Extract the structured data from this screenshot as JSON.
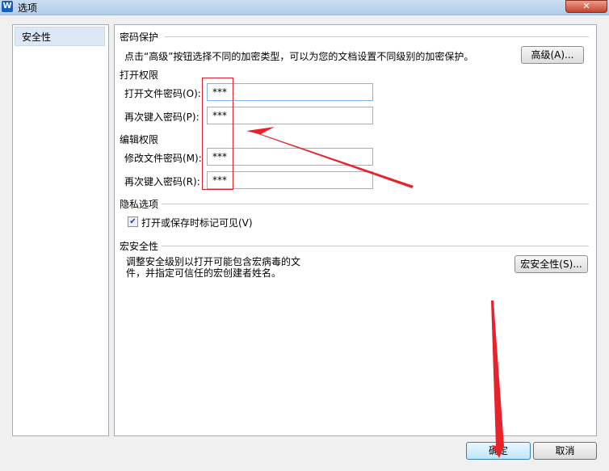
{
  "window": {
    "title": "选项",
    "app_icon_letter": "W"
  },
  "sidebar": {
    "items": [
      {
        "label": "安全性"
      }
    ]
  },
  "password_protection": {
    "section_title": "密码保护",
    "description": "点击“高级”按钮选择不同的加密类型，可以为您的文档设置不同级别的加密保护。",
    "advanced_button": "高级(A)..."
  },
  "open_permission": {
    "title": "打开权限",
    "open_password_label": "打开文件密码(O):",
    "open_password_value": "***",
    "confirm_label": "再次键入密码(P):",
    "confirm_value": "***"
  },
  "edit_permission": {
    "title": "编辑权限",
    "modify_password_label": "修改文件密码(M):",
    "modify_password_value": "***",
    "confirm_label": "再次键入密码(R):",
    "confirm_value": "***"
  },
  "privacy": {
    "section_title": "隐私选项",
    "checkbox_label": "打开或保存时标记可见(V)",
    "checked": true
  },
  "macro_security": {
    "section_title": "宏安全性",
    "description_line1": "调整安全级别以打开可能包含宏病毒的文",
    "description_line2": "件，并指定可信任的宏创建者姓名。",
    "button": "宏安全性(S)..."
  },
  "footer": {
    "ok_button": "确定",
    "cancel_button": "取消"
  },
  "colors": {
    "annotation_red": "#e8222a",
    "title_bar": "#c9ddf3"
  }
}
